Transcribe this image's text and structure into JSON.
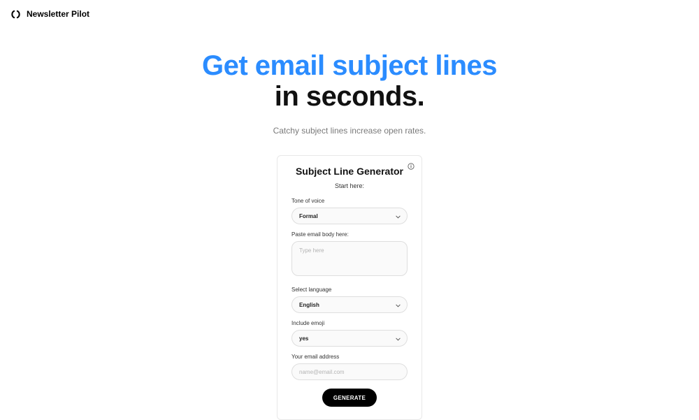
{
  "header": {
    "brand": "Newsletter Pilot"
  },
  "hero": {
    "title_line1": "Get email subject lines",
    "title_line2": "in seconds.",
    "subtitle": "Catchy subject lines increase open rates."
  },
  "card": {
    "title": "Subject Line Generator",
    "start_here": "Start here:",
    "fields": {
      "tone": {
        "label": "Tone of voice",
        "value": "Formal"
      },
      "email_body": {
        "label": "Paste email body here:",
        "placeholder": "Type here"
      },
      "language": {
        "label": "Select language",
        "value": "English"
      },
      "emoji": {
        "label": "Include emoji",
        "value": "yes"
      },
      "email": {
        "label": "Your email address",
        "placeholder": "name@email.com"
      }
    },
    "generate_label": "GENERATE"
  }
}
